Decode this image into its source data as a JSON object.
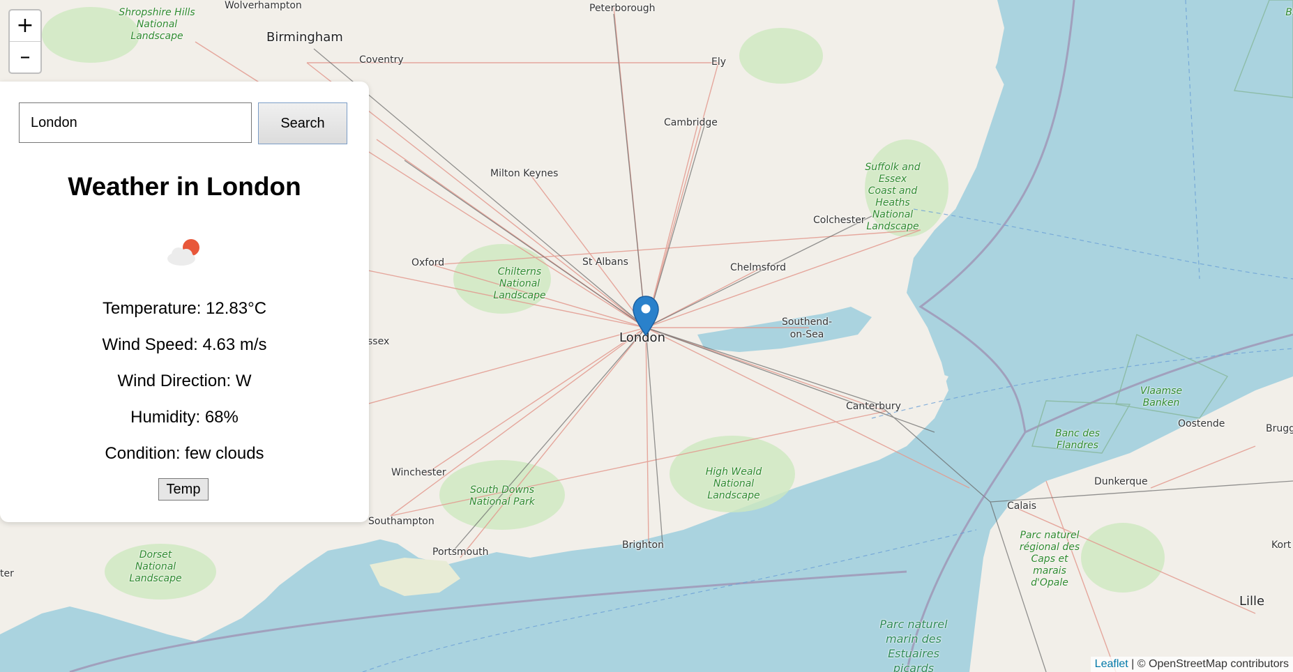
{
  "map": {
    "zoom_in_label": "+",
    "zoom_out_label": "–",
    "marker_icon": "map-marker-icon",
    "attribution": {
      "link_text": "Leaflet",
      "separator": " | ",
      "credit_text": "© OpenStreetMap contributors"
    },
    "colors": {
      "land": "#f2efe9",
      "sea": "#aad3df",
      "marker": "#2a81cb"
    },
    "places": [
      {
        "name": "Wolverhampton",
        "size": "small"
      },
      {
        "name": "Birmingham",
        "size": "big"
      },
      {
        "name": "Coventry",
        "size": "small"
      },
      {
        "name": "Peterborough",
        "size": "small"
      },
      {
        "name": "Ely",
        "size": "small"
      },
      {
        "name": "Cambridge",
        "size": "small"
      },
      {
        "name": "Milton Keynes",
        "size": "small"
      },
      {
        "name": "Colchester",
        "size": "small"
      },
      {
        "name": "Oxford",
        "size": "small"
      },
      {
        "name": "St Albans",
        "size": "small"
      },
      {
        "name": "Chelmsford",
        "size": "small"
      },
      {
        "name": "London",
        "size": "big"
      },
      {
        "name": "Southend-on-Sea",
        "size": "small"
      },
      {
        "name": "Canterbury",
        "size": "small"
      },
      {
        "name": "Winchester",
        "size": "small"
      },
      {
        "name": "Southampton",
        "size": "small"
      },
      {
        "name": "Portsmouth",
        "size": "small"
      },
      {
        "name": "Brighton",
        "size": "small"
      },
      {
        "name": "Calais",
        "size": "small"
      },
      {
        "name": "Dunkerque",
        "size": "small"
      },
      {
        "name": "Oostende",
        "size": "small"
      },
      {
        "name": "Brugge",
        "size": "small"
      },
      {
        "name": "Lille",
        "size": "big"
      },
      {
        "name": "Kort",
        "size": "small"
      },
      {
        "name": "ssex",
        "size": "small"
      },
      {
        "name": "ter",
        "size": "small"
      }
    ],
    "parks": [
      "Shropshire Hills National Landscape",
      "Suffolk and Essex Coast and Heaths National Landscape",
      "Chilterns National Landscape",
      "Vlaamse Banken",
      "Banc des Flandres",
      "High Weald National Landscape",
      "South Downs National Park",
      "Dorset National Landscape",
      "Parc naturel régional des Caps et marais d'Opale",
      "Parc naturel marin des Estuaires picards",
      "Bi"
    ]
  },
  "weather": {
    "search_value": "London",
    "search_button": "Search",
    "title": "Weather in London",
    "icon": "few-clouds-icon",
    "temperature": "Temperature: 12.83°C",
    "wind_speed": "Wind Speed: 4.63 m/s",
    "wind_direction": "Wind Direction: W",
    "humidity": "Humidity: 68%",
    "condition": "Condition: few clouds",
    "temp_button": "Temp"
  }
}
